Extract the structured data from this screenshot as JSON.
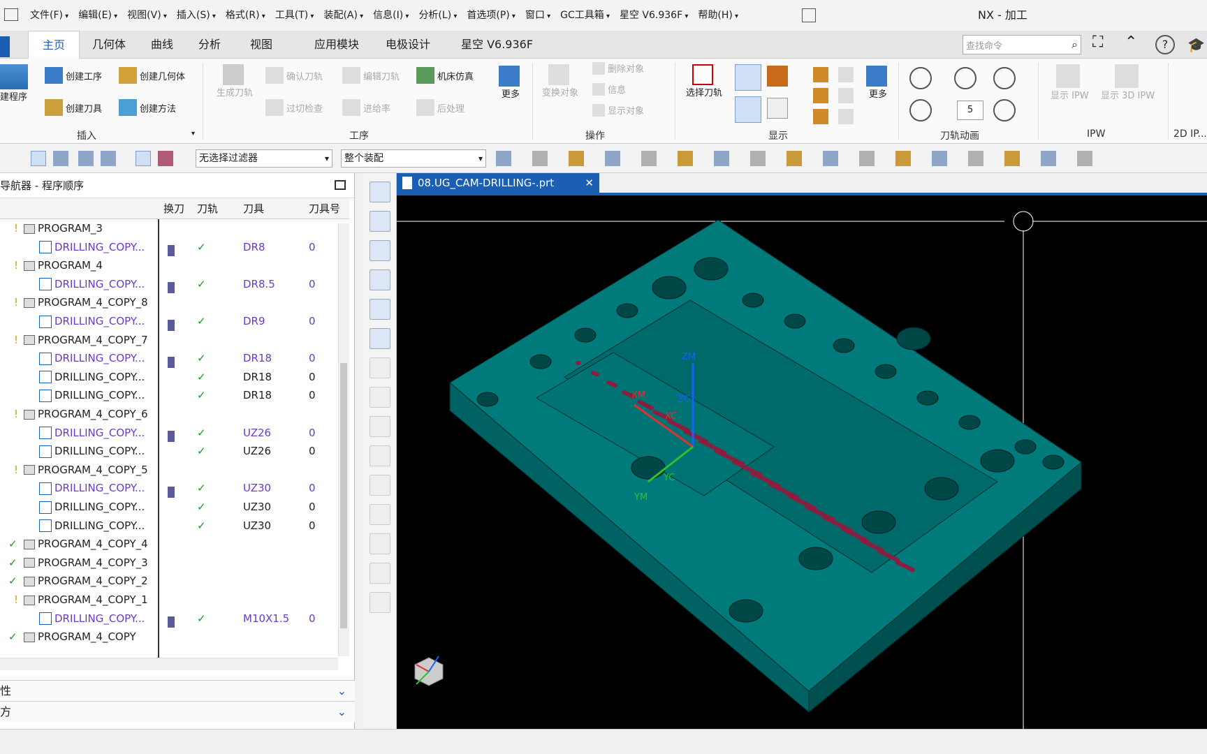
{
  "menubar": {
    "items": [
      "文件(F)",
      "编辑(E)",
      "视图(V)",
      "插入(S)",
      "格式(R)",
      "工具(T)",
      "装配(A)",
      "信息(I)",
      "分析(L)",
      "首选项(P)",
      "窗口",
      "GC工具箱",
      "星空 V6.936F",
      "帮助(H)"
    ],
    "title": "NX - 加工"
  },
  "tabs": [
    "主页",
    "几何体",
    "曲线",
    "分析",
    "视图",
    "应用模块",
    "电极设计",
    "星空 V6.936F"
  ],
  "search": {
    "placeholder": "查找命令"
  },
  "ribbon": {
    "insert": {
      "label": "插入",
      "create_program": "建程序",
      "create_operation": "创建工序",
      "create_geometry": "创建几何体",
      "create_tool": "创建刀具",
      "create_method": "创建方法"
    },
    "operation": {
      "label": "工序",
      "generate": "生成刀轨",
      "confirm": "确认刀轨",
      "edit": "编辑刀轨",
      "machine_sim": "机床仿真",
      "gouge_check": "过切检查",
      "feed": "进给率",
      "post": "后处理",
      "more": "更多"
    },
    "ops": {
      "label": "操作",
      "transform": "变换对象",
      "delete": "删除对象",
      "info": "信息",
      "show": "显示对象"
    },
    "display": {
      "label": "显示",
      "select_path": "选择刀轨",
      "more": "更多"
    },
    "animation": {
      "label": "刀轨动画",
      "speed": "5"
    },
    "ipw": {
      "label": "IPW",
      "show_ipw": "显示 IPW",
      "show_3d_ipw": "显示 3D IPW"
    },
    "ip2d": {
      "label": "2D IP..."
    }
  },
  "filters": {
    "selection": "无选择过滤器",
    "assembly": "整个装配"
  },
  "navigator": {
    "title": "导航器 - 程序顺序",
    "columns": [
      "换刀",
      "刀轨",
      "刀具",
      "刀具号"
    ],
    "rows": [
      {
        "name": "PROGRAM_3",
        "type": "program"
      },
      {
        "name": "DRILLING_COPY...",
        "type": "op",
        "purple": true,
        "toolchange": true,
        "ok": "✓",
        "tool": "DR8",
        "num": "0"
      },
      {
        "name": "PROGRAM_4",
        "type": "program"
      },
      {
        "name": "DRILLING_COPY...",
        "type": "op",
        "purple": true,
        "toolchange": true,
        "ok": "✓",
        "tool": "DR8.5",
        "num": "0"
      },
      {
        "name": "PROGRAM_4_COPY_8",
        "type": "program"
      },
      {
        "name": "DRILLING_COPY...",
        "type": "op",
        "purple": true,
        "toolchange": true,
        "ok": "✓",
        "tool": "DR9",
        "num": "0"
      },
      {
        "name": "PROGRAM_4_COPY_7",
        "type": "program"
      },
      {
        "name": "DRILLING_COPY...",
        "type": "op",
        "purple": true,
        "toolchange": true,
        "ok": "✓",
        "tool": "DR18",
        "num": "0"
      },
      {
        "name": "DRILLING_COPY...",
        "type": "op",
        "purple": false,
        "toolchange": false,
        "ok": "✓",
        "tool": "DR18",
        "num": "0"
      },
      {
        "name": "DRILLING_COPY...",
        "type": "op",
        "purple": false,
        "toolchange": false,
        "ok": "✓",
        "tool": "DR18",
        "num": "0"
      },
      {
        "name": "PROGRAM_4_COPY_6",
        "type": "program"
      },
      {
        "name": "DRILLING_COPY...",
        "type": "op",
        "purple": true,
        "toolchange": true,
        "ok": "✓",
        "tool": "UZ26",
        "num": "0"
      },
      {
        "name": "DRILLING_COPY...",
        "type": "op",
        "purple": false,
        "toolchange": false,
        "ok": "✓",
        "tool": "UZ26",
        "num": "0"
      },
      {
        "name": "PROGRAM_4_COPY_5",
        "type": "program"
      },
      {
        "name": "DRILLING_COPY...",
        "type": "op",
        "purple": true,
        "toolchange": true,
        "ok": "✓",
        "tool": "UZ30",
        "num": "0"
      },
      {
        "name": "DRILLING_COPY...",
        "type": "op",
        "purple": false,
        "toolchange": false,
        "ok": "✓",
        "tool": "UZ30",
        "num": "0"
      },
      {
        "name": "DRILLING_COPY...",
        "type": "op",
        "purple": false,
        "toolchange": false,
        "ok": "✓",
        "tool": "UZ30",
        "num": "0"
      },
      {
        "name": "PROGRAM_4_COPY_4",
        "type": "program",
        "done": true
      },
      {
        "name": "PROGRAM_4_COPY_3",
        "type": "program",
        "done": true
      },
      {
        "name": "PROGRAM_4_COPY_2",
        "type": "program",
        "done": true
      },
      {
        "name": "PROGRAM_4_COPY_1",
        "type": "program"
      },
      {
        "name": "DRILLING_COPY...",
        "type": "op",
        "purple": true,
        "toolchange": true,
        "ok": "✓",
        "tool": "M10X1.5",
        "num": "0"
      },
      {
        "name": "PROGRAM_4_COPY",
        "type": "program",
        "done": true
      }
    ],
    "panel_props": "性",
    "panel_other": "方"
  },
  "document": {
    "tab": "08.UG_CAM-DRILLING-.prt"
  },
  "axes": {
    "zm": "ZM",
    "zc": "ZC",
    "xm": "XM",
    "xc": "XC",
    "ym": "YM",
    "yc": "YC"
  },
  "colors": {
    "accent": "#1a5fb4",
    "model": "#007a7a",
    "hole": "#8b1e3f",
    "ok": "#1b9a1b"
  }
}
